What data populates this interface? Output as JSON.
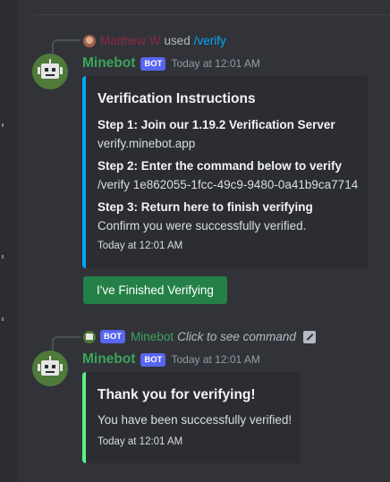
{
  "colors": {
    "background": "#313338",
    "embed_bg": "#2b2d31",
    "embed_border_blue": "#00a8fc",
    "embed_border_green": "#57f287",
    "bot_badge": "#5865f2",
    "bot_name": "#3ba55c",
    "user_name": "#8f2a43",
    "button": "#248046"
  },
  "message1": {
    "reply": {
      "user_name": "Matthew W",
      "action_text": "used",
      "command": "/verify"
    },
    "author": "Minebot",
    "badge": "BOT",
    "timestamp": "Today at 12:01 AM",
    "avatar_icon": "robot-icon",
    "embed": {
      "title": "Verification Instructions",
      "fields": [
        {
          "name": "Step 1: Join our 1.19.2 Verification Server",
          "value": "verify.minebot.app"
        },
        {
          "name": "Step 2: Enter the command below to verify",
          "value": "/verify 1e862055-1fcc-49c9-9480-0a41b9ca7714"
        },
        {
          "name": "Step 3: Return here to finish verifying",
          "value": "Confirm you were successfully verified."
        }
      ],
      "footer": "Today at 12:01 AM"
    },
    "button_label": "I've Finished Verifying"
  },
  "message2": {
    "reply": {
      "badge": "BOT",
      "bot_name": "Minebot",
      "hint": "Click to see command"
    },
    "author": "Minebot",
    "badge": "BOT",
    "timestamp": "Today at 12:01 AM",
    "avatar_icon": "robot-icon",
    "embed": {
      "title": "Thank you for verifying!",
      "description": "You have been successfully verified!",
      "footer": "Today at 12:01 AM"
    }
  }
}
